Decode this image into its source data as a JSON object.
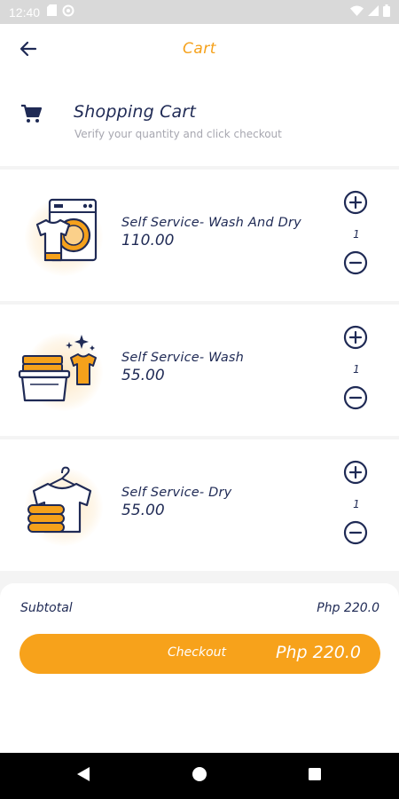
{
  "status_bar": {
    "time": "12:40",
    "left_icons": [
      "sd-card-icon",
      "data-saver-icon"
    ],
    "right_icons": [
      "wifi-icon",
      "signal-icon",
      "battery-icon"
    ]
  },
  "app_bar": {
    "title": "Cart",
    "back_icon": "arrow-left-icon"
  },
  "header": {
    "icon": "shopping-cart-icon",
    "title": "Shopping Cart",
    "subtitle": "Verify your quantity and click checkout"
  },
  "items": [
    {
      "name": "Self Service- Wash And Dry",
      "price": "110.00",
      "quantity": "1",
      "illustration": "washing-machine-shirt-icon"
    },
    {
      "name": "Self Service- Wash",
      "price": "55.00",
      "quantity": "1",
      "illustration": "basket-shirt-sparkle-icon"
    },
    {
      "name": "Self Service- Dry",
      "price": "55.00",
      "quantity": "1",
      "illustration": "hanger-shirt-towels-icon"
    }
  ],
  "footer": {
    "subtotal_label": "Subtotal",
    "subtotal_value": "Php 220.0",
    "checkout_label": "Checkout",
    "checkout_total": "Php 220.0"
  },
  "colors": {
    "accent": "#f7a21b",
    "navy": "#1f2a55",
    "muted": "#a7a7b0"
  },
  "nav_bar": {
    "icons": [
      "back-triangle-icon",
      "home-circle-icon",
      "recents-square-icon"
    ]
  }
}
